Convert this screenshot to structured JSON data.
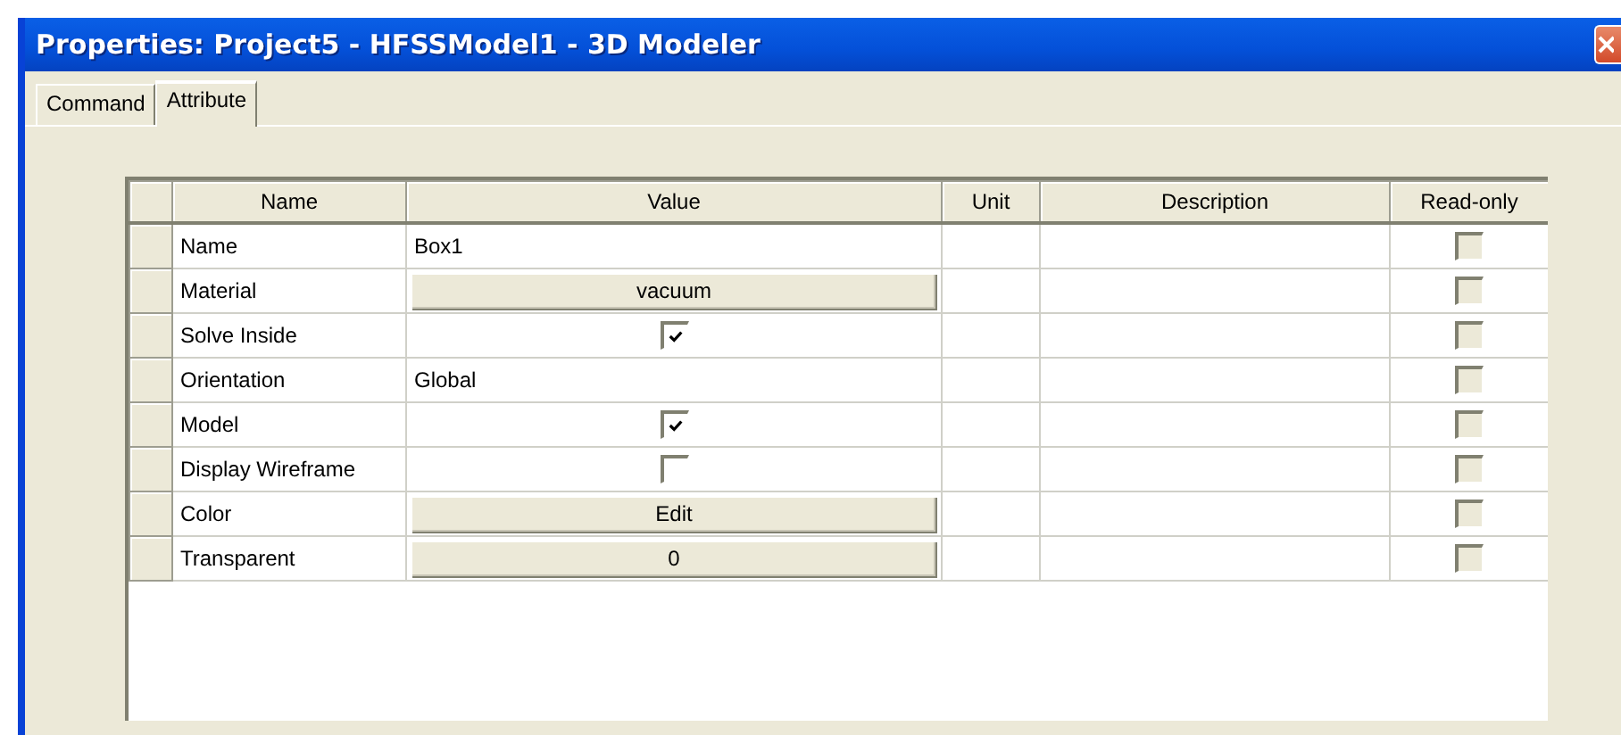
{
  "window": {
    "title": "Properties: Project5 - HFSSModel1 - 3D Modeler"
  },
  "tabs": [
    {
      "label": "Command",
      "selected": false
    },
    {
      "label": "Attribute",
      "selected": true
    }
  ],
  "table": {
    "columns": [
      "Name",
      "Value",
      "Unit",
      "Description",
      "Read-only"
    ],
    "rows": [
      {
        "name": "Name",
        "kind": "text",
        "value": "Box1",
        "read_only": false
      },
      {
        "name": "Material",
        "kind": "button",
        "value": "vacuum",
        "read_only": false
      },
      {
        "name": "Solve Inside",
        "kind": "checkbox",
        "checked": true,
        "read_only": false
      },
      {
        "name": "Orientation",
        "kind": "text",
        "value": "Global",
        "read_only": false
      },
      {
        "name": "Model",
        "kind": "checkbox",
        "checked": true,
        "read_only": false
      },
      {
        "name": "Display Wireframe",
        "kind": "checkbox",
        "checked": false,
        "read_only": false
      },
      {
        "name": "Color",
        "kind": "button",
        "value": "Edit",
        "read_only": false
      },
      {
        "name": "Transparent",
        "kind": "button",
        "value": "0",
        "read_only": false
      }
    ]
  }
}
